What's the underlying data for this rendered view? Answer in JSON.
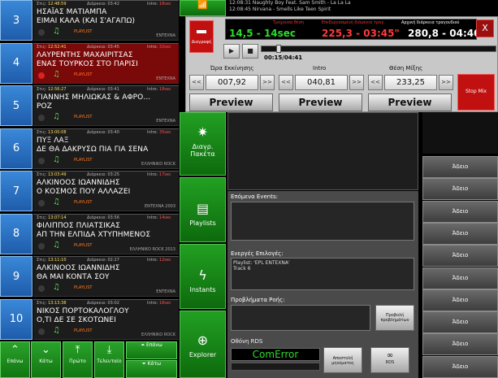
{
  "playlist": [
    {
      "num": "3",
      "start_label": "Στις:",
      "start": "12:48:59",
      "dur_label": "Διάρκεια:",
      "duration": "03:42",
      "int_label": "Intro:",
      "intro": "18sec",
      "title1": "ΗΣΑΪΑΣ ΜΑΤΙΑΜΠΑ",
      "title2": "ΕΙΜΑΙ ΚΑΛΑ (ΚΑΙ Σ'ΑΓΑΠΩ)",
      "playlist_label": "PLAYLIST",
      "genre": "ENTEXNA",
      "active": false
    },
    {
      "num": "4",
      "start_label": "Στις:",
      "start": "12:52:41",
      "dur_label": "Διάρκεια:",
      "duration": "03:45",
      "int_label": "Intro:",
      "intro": "32sec",
      "title1": "ΛΑΥΡΕΝΤΗΣ ΜΑΧΑΙΡΙΤΣΑΣ",
      "title2": "ΕΝΑΣ ΤΟΥΡΚΟΣ ΣΤΟ ΠΑΡΙΣΙ",
      "playlist_label": "PLAYLIST",
      "genre": "ENTEXNA",
      "active": true
    },
    {
      "num": "5",
      "start_label": "Στις:",
      "start": "12:56:27",
      "dur_label": "Διάρκεια:",
      "duration": "03:41",
      "int_label": "Intro:",
      "intro": "18sec",
      "title1": "ΓΙΑΝΝΗΣ ΜΗΛΙΩΚΑΣ & ΑΦΡΟ...",
      "title2": "ΡΟΖ",
      "playlist_label": "PLAYLIST",
      "genre": "ENTEXNA",
      "active": false
    },
    {
      "num": "6",
      "start_label": "Στις:",
      "start": "13:00:08",
      "dur_label": "Διάρκεια:",
      "duration": "03:40",
      "int_label": "Intro:",
      "intro": "35sec",
      "title1": "ΠΥΞ ΛΑΞ",
      "title2": "ΔΕ ΘΑ ΔΑΚΡΥΣΩ ΠΙΑ ΓΙΑ ΣΕΝΑ",
      "playlist_label": "PLAYLIST",
      "genre": "ΕΛΛΗΝΙΚΟ ROCK",
      "active": false
    },
    {
      "num": "7",
      "start_label": "Στις:",
      "start": "13:03:49",
      "dur_label": "Διάρκεια:",
      "duration": "03:25",
      "int_label": "Intro:",
      "intro": "17sec",
      "title1": "ΑΛΚΙΝΟΟΣ ΙΩΑΝΝΙΔΗΣ",
      "title2": "Ο ΚΟΣΜΟΣ ΠΟΥ ΑΛΛΑΖΕΙ",
      "playlist_label": "PLAYLIST",
      "genre": "ENTEXNA 2003",
      "active": false
    },
    {
      "num": "8",
      "start_label": "Στις:",
      "start": "13:07:14",
      "dur_label": "Διάρκεια:",
      "duration": "03:56",
      "int_label": "Intro:",
      "intro": "14sec",
      "title1": "ΦΙΛΙΠΠΟΣ ΠΛΙΑΤΣΙΚΑΣ",
      "title2": "ΑΠ ΤΗΝ ΕΛΠΙΔΑ ΧΤΥΠΗΜΕΝΟΣ",
      "playlist_label": "PLAYLIST",
      "genre": "ΕΛΛΗΝΙΚΟ ROCK 2013",
      "active": false
    },
    {
      "num": "9",
      "start_label": "Στις:",
      "start": "13:11:10",
      "dur_label": "Διάρκεια:",
      "duration": "02:27",
      "int_label": "Intro:",
      "intro": "12sec",
      "title1": "ΑΛΚΙΝΟΟΣ ΙΩΑΝΝΙΔΗΣ",
      "title2": "ΘΑ ΜΑΙ ΚΟΝΤΑ ΣΟΥ",
      "playlist_label": "PLAYLIST",
      "genre": "ENTEXNA",
      "active": false
    },
    {
      "num": "10",
      "start_label": "Στις:",
      "start": "13:13:38",
      "dur_label": "Διάρκεια:",
      "duration": "03:02",
      "int_label": "Intro:",
      "intro": "18sec",
      "title1": "ΝΙΚΟΣ ΠΟΡΤΟΚΑΛΟΓΛΟΥ",
      "title2": "Ο,ΤΙ ΔΕ ΣΕ ΣΚΟΤΩΝΕΙ",
      "playlist_label": "PLAYLIST",
      "genre": "ΕΛΛΗΝΙΚΟ ROCK",
      "active": false
    }
  ],
  "nav": {
    "up": "Επάνω",
    "down": "Κάτω",
    "first": "Πρώτο",
    "last": "Τελευταίο",
    "page_up": "Επάνω",
    "page_down": "Κάτω"
  },
  "side": {
    "del_packets": "Διαγρ. Πακέτα",
    "playlists": "Playlists",
    "instants": "Instants",
    "explorer": "Explorer"
  },
  "history": [
    "12:08:31 Naughty Boy Feat. Sam Smith - La La La",
    "12:08:45 Nirvana - Smells Like Teen Spirit",
    "12:09:00 Mia Martini - Latin Moon"
  ],
  "player": {
    "delete_label": "Διαγραφή",
    "lcd_label1": "Τρέχουσα θέση",
    "lcd_label2": "Επεξεργασμένη διάρκεια τραγ.",
    "lcd_label3": "Αρχική διάρκεια τραγουδιού",
    "pos": "14,5 - 14sec",
    "edited": "225,3 - 03:45\"",
    "orig": "280,8 - 04:40\"",
    "close": "X",
    "play_icon": "▶",
    "stop_icon": "■",
    "progress": 0.062,
    "time": "00:15/04:41",
    "start_label": "Ώρα Εκκίνησης",
    "intro_label": "Intro",
    "mix_label": "Θέση Μίξης",
    "start_val": "007,92",
    "intro_val": "040,81",
    "mix_val": "233,25",
    "prev_arrow": "<<",
    "next_arrow": ">>",
    "preview": "Preview",
    "stop_mix": "Stop Mix"
  },
  "center": {
    "next_events": "Επόμενα Events:",
    "active_options": "Ενεργές Επιλογές:",
    "active_line1": "Playlist: 'EPL ENTEXNA'",
    "active_line2": "Track 6",
    "flow_problems": "Προβλήματα Ροής:",
    "show_problems": "Προβολή προβλημάτων",
    "rds_label": "Οθόνη RDS",
    "com_error": "ComError",
    "send_message": "Αποστολή μηνύματος",
    "rds": "RDS"
  },
  "slots": [
    "Άδειο",
    "Άδειο",
    "Άδειο",
    "Άδειο",
    "Άδειο",
    "Άδειο",
    "Άδειο",
    "Άδειο",
    "Άδειο",
    "Άδειο"
  ],
  "colors": {
    "accent": "#1e5cab",
    "green": "#117611",
    "red": "#c01010",
    "lcd_green": "#2bdc2b"
  }
}
